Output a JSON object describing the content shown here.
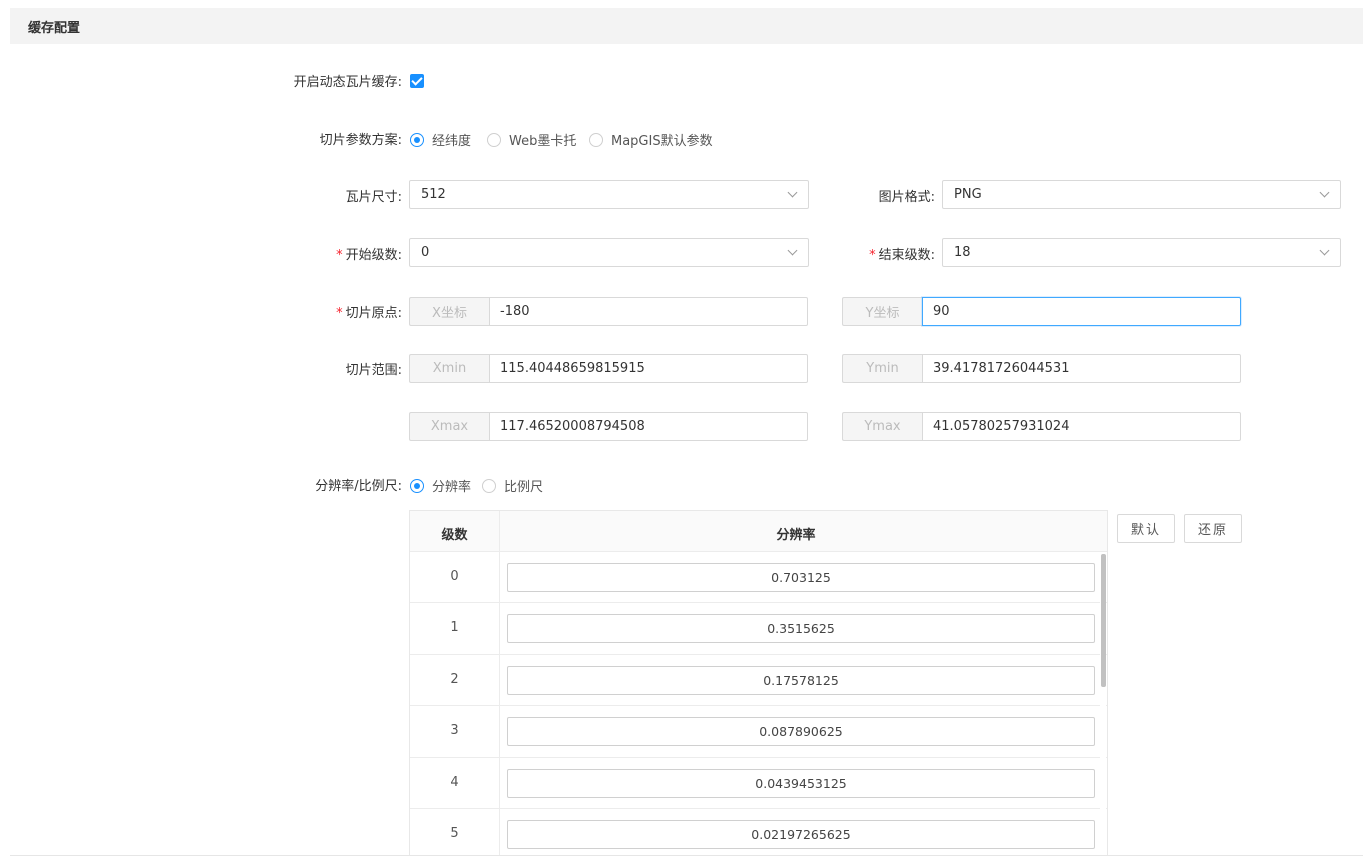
{
  "section": {
    "title": "缓存配置"
  },
  "dynamic_cache": {
    "label": "开启动态瓦片缓存:",
    "checked": true
  },
  "scheme": {
    "label": "切片参数方案:",
    "options": [
      "经纬度",
      "Web墨卡托",
      "MapGIS默认参数"
    ],
    "selected": "经纬度"
  },
  "tile_size": {
    "label": "瓦片尺寸:",
    "value": "512"
  },
  "image_format": {
    "label": "图片格式:",
    "value": "PNG"
  },
  "start_level": {
    "required_mark": "*",
    "label": "开始级数:",
    "value": "0"
  },
  "end_level": {
    "required_mark": "*",
    "label": "结束级数:",
    "value": "18"
  },
  "origin": {
    "required_mark": "*",
    "label": "切片原点:",
    "x_addon": "X坐标",
    "x_value": "-180",
    "y_addon": "Y坐标",
    "y_value": "90"
  },
  "extent": {
    "label": "切片范围:",
    "xmin_addon": "Xmin",
    "xmin_value": "115.40448659815915",
    "ymin_addon": "Ymin",
    "ymin_value": "39.41781726044531",
    "xmax_addon": "Xmax",
    "xmax_value": "117.46520008794508",
    "ymax_addon": "Ymax",
    "ymax_value": "41.05780257931024"
  },
  "resolution_mode": {
    "label": "分辨率/比例尺:",
    "options": [
      "分辨率",
      "比例尺"
    ],
    "selected": "分辨率"
  },
  "buttons": {
    "default": "默认",
    "restore": "还原"
  },
  "table": {
    "headers": [
      "级数",
      "分辨率"
    ],
    "rows": [
      {
        "level": "0",
        "resolution": "0.703125"
      },
      {
        "level": "1",
        "resolution": "0.3515625"
      },
      {
        "level": "2",
        "resolution": "0.17578125"
      },
      {
        "level": "3",
        "resolution": "0.087890625"
      },
      {
        "level": "4",
        "resolution": "0.0439453125"
      },
      {
        "level": "5",
        "resolution": "0.02197265625"
      }
    ]
  },
  "colors": {
    "accent": "#1890ff",
    "required": "#f5222d",
    "header_bg": "#f3f3f3"
  }
}
